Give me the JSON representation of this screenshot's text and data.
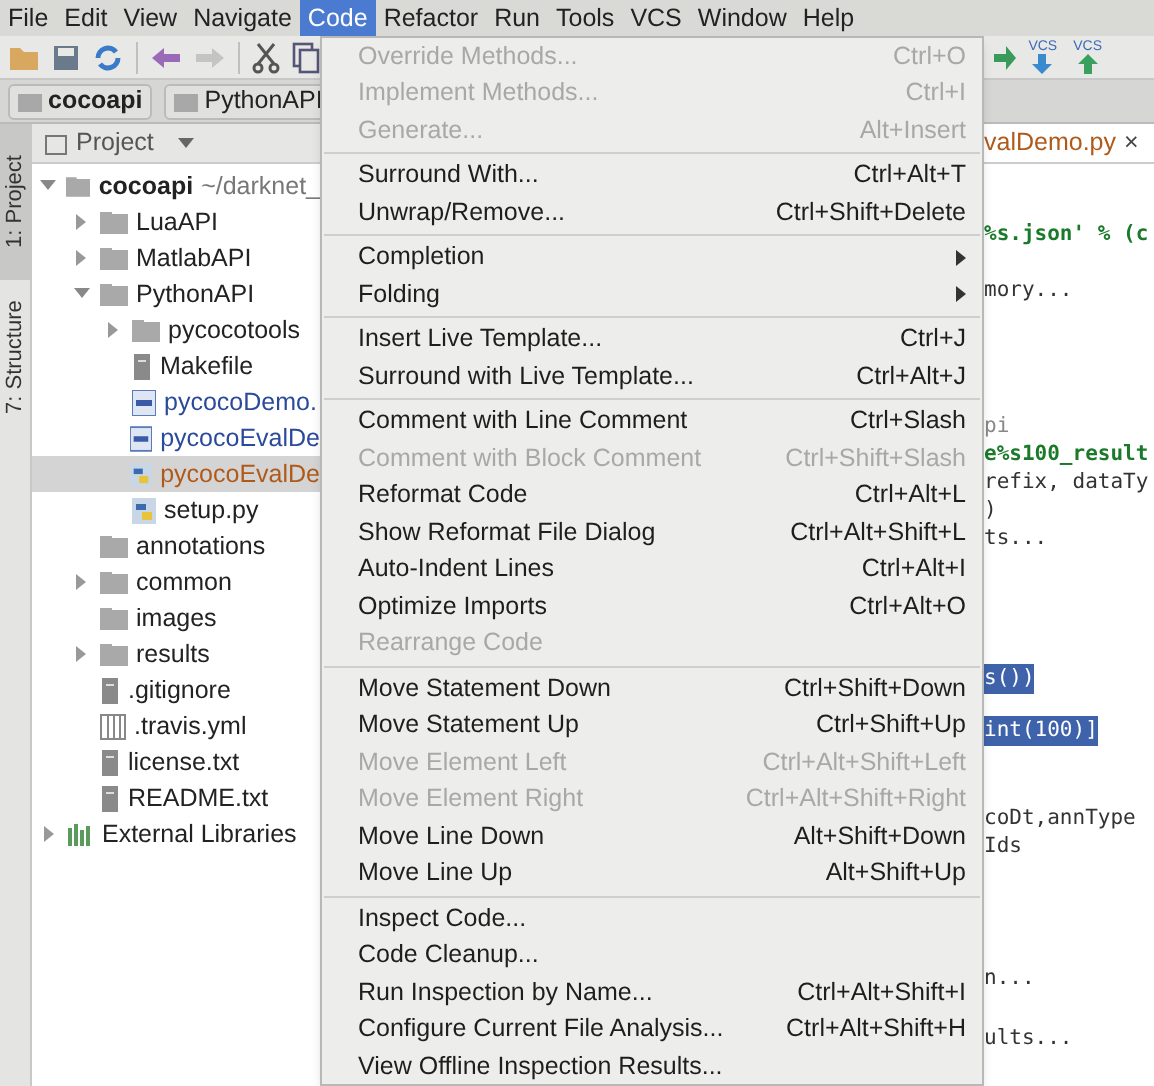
{
  "menu_bar": [
    {
      "label": "File",
      "selected": false
    },
    {
      "label": "Edit",
      "selected": false
    },
    {
      "label": "View",
      "selected": false
    },
    {
      "label": "Navigate",
      "selected": false
    },
    {
      "label": "Code",
      "selected": true
    },
    {
      "label": "Refactor",
      "selected": false
    },
    {
      "label": "Run",
      "selected": false
    },
    {
      "label": "Tools",
      "selected": false
    },
    {
      "label": "VCS",
      "selected": false
    },
    {
      "label": "Window",
      "selected": false
    },
    {
      "label": "Help",
      "selected": false
    }
  ],
  "toolbar_right": [
    "VCS",
    "VCS"
  ],
  "breadcrumbs": [
    "cocoapi",
    "PythonAPI"
  ],
  "side_tabs": [
    {
      "label": "1: Project",
      "selected": true
    },
    {
      "label": "7: Structure",
      "selected": false
    }
  ],
  "project_panel": {
    "title": "Project"
  },
  "tree": [
    {
      "label": "cocoapi",
      "path": "~/darknet_",
      "kind": "folder",
      "expanded": true,
      "selected": false,
      "children": [
        {
          "label": "LuaAPI",
          "kind": "folder",
          "expanded": false,
          "selected": false
        },
        {
          "label": "MatlabAPI",
          "kind": "folder",
          "expanded": false,
          "selected": false
        },
        {
          "label": "PythonAPI",
          "kind": "folder",
          "expanded": true,
          "selected": false,
          "children": [
            {
              "label": "pycocotools",
              "kind": "folder",
              "expanded": false,
              "selected": false
            },
            {
              "label": "Makefile",
              "kind": "file",
              "selected": false
            },
            {
              "label": "pycocoDemo.",
              "kind": "notebook",
              "selected": false
            },
            {
              "label": "pycocoEvalDe",
              "kind": "notebook",
              "selected": false
            },
            {
              "label": "pycocoEvalDe",
              "kind": "python",
              "selected": true
            },
            {
              "label": "setup.py",
              "kind": "python",
              "selected": false
            }
          ]
        },
        {
          "label": "annotations",
          "kind": "folder",
          "selected": false
        },
        {
          "label": "common",
          "kind": "folder",
          "expanded": false,
          "selected": false
        },
        {
          "label": "images",
          "kind": "folder",
          "selected": false
        },
        {
          "label": "results",
          "kind": "folder",
          "expanded": false,
          "selected": false
        },
        {
          "label": ".gitignore",
          "kind": "file",
          "selected": false
        },
        {
          "label": ".travis.yml",
          "kind": "table",
          "selected": false
        },
        {
          "label": "license.txt",
          "kind": "file",
          "selected": false
        },
        {
          "label": "README.txt",
          "kind": "file",
          "selected": false
        }
      ]
    },
    {
      "label": "External Libraries",
      "kind": "library",
      "expanded": false,
      "selected": false
    }
  ],
  "editor": {
    "tab": "valDemo.py",
    "tab_close": "×",
    "lines": [
      {
        "text": "%s.json' % (c",
        "kind": "string",
        "selected": false
      },
      {
        "text": "mory...",
        "kind": "plain",
        "selected": false
      },
      {
        "text": "pi",
        "kind": "comment",
        "selected": false
      },
      {
        "text": "e%s100_result",
        "kind": "string",
        "selected": false
      },
      {
        "text": "refix, dataTy",
        "kind": "plain",
        "selected": false
      },
      {
        "text": ")",
        "kind": "plain",
        "selected": false
      },
      {
        "text": "ts...",
        "kind": "plain",
        "selected": false
      },
      {
        "text": "s())",
        "kind": "plain",
        "selected": true
      },
      {
        "text": "int(100)]",
        "kind": "plain",
        "selected": true
      },
      {
        "text": "coDt,annType",
        "kind": "plain",
        "selected": false
      },
      {
        "text": "Ids",
        "kind": "plain",
        "selected": false
      },
      {
        "text": "n...",
        "kind": "plain",
        "selected": false
      },
      {
        "text": "ults...",
        "kind": "plain",
        "selected": false
      }
    ]
  },
  "code_menu": [
    [
      {
        "label": "Override Methods...",
        "shortcut": "Ctrl+O",
        "disabled": true
      },
      {
        "label": "Implement Methods...",
        "shortcut": "Ctrl+I",
        "disabled": true
      },
      {
        "label": "Generate...",
        "shortcut": "Alt+Insert",
        "disabled": true
      }
    ],
    [
      {
        "label": "Surround With...",
        "shortcut": "Ctrl+Alt+T",
        "disabled": false
      },
      {
        "label": "Unwrap/Remove...",
        "shortcut": "Ctrl+Shift+Delete",
        "disabled": false
      }
    ],
    [
      {
        "label": "Completion",
        "submenu": true,
        "disabled": false
      },
      {
        "label": "Folding",
        "submenu": true,
        "disabled": false
      }
    ],
    [
      {
        "label": "Insert Live Template...",
        "shortcut": "Ctrl+J",
        "disabled": false
      },
      {
        "label": "Surround with Live Template...",
        "shortcut": "Ctrl+Alt+J",
        "disabled": false
      }
    ],
    [
      {
        "label": "Comment with Line Comment",
        "shortcut": "Ctrl+Slash",
        "disabled": false
      },
      {
        "label": "Comment with Block Comment",
        "shortcut": "Ctrl+Shift+Slash",
        "disabled": true
      },
      {
        "label": "Reformat Code",
        "shortcut": "Ctrl+Alt+L",
        "disabled": false
      },
      {
        "label": "Show Reformat File Dialog",
        "shortcut": "Ctrl+Alt+Shift+L",
        "disabled": false
      },
      {
        "label": "Auto-Indent Lines",
        "shortcut": "Ctrl+Alt+I",
        "disabled": false
      },
      {
        "label": "Optimize Imports",
        "shortcut": "Ctrl+Alt+O",
        "disabled": false
      },
      {
        "label": "Rearrange Code",
        "disabled": true
      }
    ],
    [
      {
        "label": "Move Statement Down",
        "shortcut": "Ctrl+Shift+Down",
        "disabled": false
      },
      {
        "label": "Move Statement Up",
        "shortcut": "Ctrl+Shift+Up",
        "disabled": false
      },
      {
        "label": "Move Element Left",
        "shortcut": "Ctrl+Alt+Shift+Left",
        "disabled": true
      },
      {
        "label": "Move Element Right",
        "shortcut": "Ctrl+Alt+Shift+Right",
        "disabled": true
      },
      {
        "label": "Move Line Down",
        "shortcut": "Alt+Shift+Down",
        "disabled": false
      },
      {
        "label": "Move Line Up",
        "shortcut": "Alt+Shift+Up",
        "disabled": false
      }
    ],
    [
      {
        "label": "Inspect Code...",
        "disabled": false
      },
      {
        "label": "Code Cleanup...",
        "disabled": false
      },
      {
        "label": "Run Inspection by Name...",
        "shortcut": "Ctrl+Alt+Shift+I",
        "disabled": false
      },
      {
        "label": "Configure Current File Analysis...",
        "shortcut": "Ctrl+Alt+Shift+H",
        "disabled": false
      },
      {
        "label": "View Offline Inspection Results...",
        "disabled": false
      }
    ]
  ]
}
